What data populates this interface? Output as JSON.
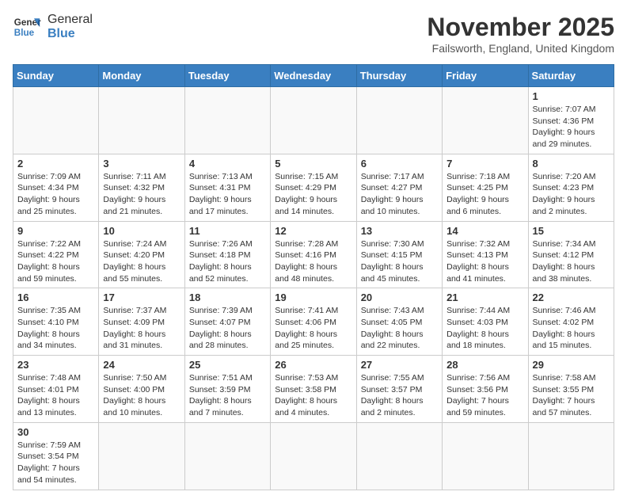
{
  "logo": {
    "line1": "General",
    "line2": "Blue"
  },
  "title": "November 2025",
  "subtitle": "Failsworth, England, United Kingdom",
  "weekdays": [
    "Sunday",
    "Monday",
    "Tuesday",
    "Wednesday",
    "Thursday",
    "Friday",
    "Saturday"
  ],
  "weeks": [
    [
      {
        "day": null
      },
      {
        "day": null
      },
      {
        "day": null
      },
      {
        "day": null
      },
      {
        "day": null
      },
      {
        "day": null
      },
      {
        "day": 1,
        "sunrise": "7:07 AM",
        "sunset": "4:36 PM",
        "daylight": "9 hours and 29 minutes."
      }
    ],
    [
      {
        "day": 2,
        "sunrise": "7:09 AM",
        "sunset": "4:34 PM",
        "daylight": "9 hours and 25 minutes."
      },
      {
        "day": 3,
        "sunrise": "7:11 AM",
        "sunset": "4:32 PM",
        "daylight": "9 hours and 21 minutes."
      },
      {
        "day": 4,
        "sunrise": "7:13 AM",
        "sunset": "4:31 PM",
        "daylight": "9 hours and 17 minutes."
      },
      {
        "day": 5,
        "sunrise": "7:15 AM",
        "sunset": "4:29 PM",
        "daylight": "9 hours and 14 minutes."
      },
      {
        "day": 6,
        "sunrise": "7:17 AM",
        "sunset": "4:27 PM",
        "daylight": "9 hours and 10 minutes."
      },
      {
        "day": 7,
        "sunrise": "7:18 AM",
        "sunset": "4:25 PM",
        "daylight": "9 hours and 6 minutes."
      },
      {
        "day": 8,
        "sunrise": "7:20 AM",
        "sunset": "4:23 PM",
        "daylight": "9 hours and 2 minutes."
      }
    ],
    [
      {
        "day": 9,
        "sunrise": "7:22 AM",
        "sunset": "4:22 PM",
        "daylight": "8 hours and 59 minutes."
      },
      {
        "day": 10,
        "sunrise": "7:24 AM",
        "sunset": "4:20 PM",
        "daylight": "8 hours and 55 minutes."
      },
      {
        "day": 11,
        "sunrise": "7:26 AM",
        "sunset": "4:18 PM",
        "daylight": "8 hours and 52 minutes."
      },
      {
        "day": 12,
        "sunrise": "7:28 AM",
        "sunset": "4:16 PM",
        "daylight": "8 hours and 48 minutes."
      },
      {
        "day": 13,
        "sunrise": "7:30 AM",
        "sunset": "4:15 PM",
        "daylight": "8 hours and 45 minutes."
      },
      {
        "day": 14,
        "sunrise": "7:32 AM",
        "sunset": "4:13 PM",
        "daylight": "8 hours and 41 minutes."
      },
      {
        "day": 15,
        "sunrise": "7:34 AM",
        "sunset": "4:12 PM",
        "daylight": "8 hours and 38 minutes."
      }
    ],
    [
      {
        "day": 16,
        "sunrise": "7:35 AM",
        "sunset": "4:10 PM",
        "daylight": "8 hours and 34 minutes."
      },
      {
        "day": 17,
        "sunrise": "7:37 AM",
        "sunset": "4:09 PM",
        "daylight": "8 hours and 31 minutes."
      },
      {
        "day": 18,
        "sunrise": "7:39 AM",
        "sunset": "4:07 PM",
        "daylight": "8 hours and 28 minutes."
      },
      {
        "day": 19,
        "sunrise": "7:41 AM",
        "sunset": "4:06 PM",
        "daylight": "8 hours and 25 minutes."
      },
      {
        "day": 20,
        "sunrise": "7:43 AM",
        "sunset": "4:05 PM",
        "daylight": "8 hours and 22 minutes."
      },
      {
        "day": 21,
        "sunrise": "7:44 AM",
        "sunset": "4:03 PM",
        "daylight": "8 hours and 18 minutes."
      },
      {
        "day": 22,
        "sunrise": "7:46 AM",
        "sunset": "4:02 PM",
        "daylight": "8 hours and 15 minutes."
      }
    ],
    [
      {
        "day": 23,
        "sunrise": "7:48 AM",
        "sunset": "4:01 PM",
        "daylight": "8 hours and 13 minutes."
      },
      {
        "day": 24,
        "sunrise": "7:50 AM",
        "sunset": "4:00 PM",
        "daylight": "8 hours and 10 minutes."
      },
      {
        "day": 25,
        "sunrise": "7:51 AM",
        "sunset": "3:59 PM",
        "daylight": "8 hours and 7 minutes."
      },
      {
        "day": 26,
        "sunrise": "7:53 AM",
        "sunset": "3:58 PM",
        "daylight": "8 hours and 4 minutes."
      },
      {
        "day": 27,
        "sunrise": "7:55 AM",
        "sunset": "3:57 PM",
        "daylight": "8 hours and 2 minutes."
      },
      {
        "day": 28,
        "sunrise": "7:56 AM",
        "sunset": "3:56 PM",
        "daylight": "7 hours and 59 minutes."
      },
      {
        "day": 29,
        "sunrise": "7:58 AM",
        "sunset": "3:55 PM",
        "daylight": "7 hours and 57 minutes."
      }
    ],
    [
      {
        "day": 30,
        "sunrise": "7:59 AM",
        "sunset": "3:54 PM",
        "daylight": "7 hours and 54 minutes."
      },
      {
        "day": null
      },
      {
        "day": null
      },
      {
        "day": null
      },
      {
        "day": null
      },
      {
        "day": null
      },
      {
        "day": null
      }
    ]
  ]
}
